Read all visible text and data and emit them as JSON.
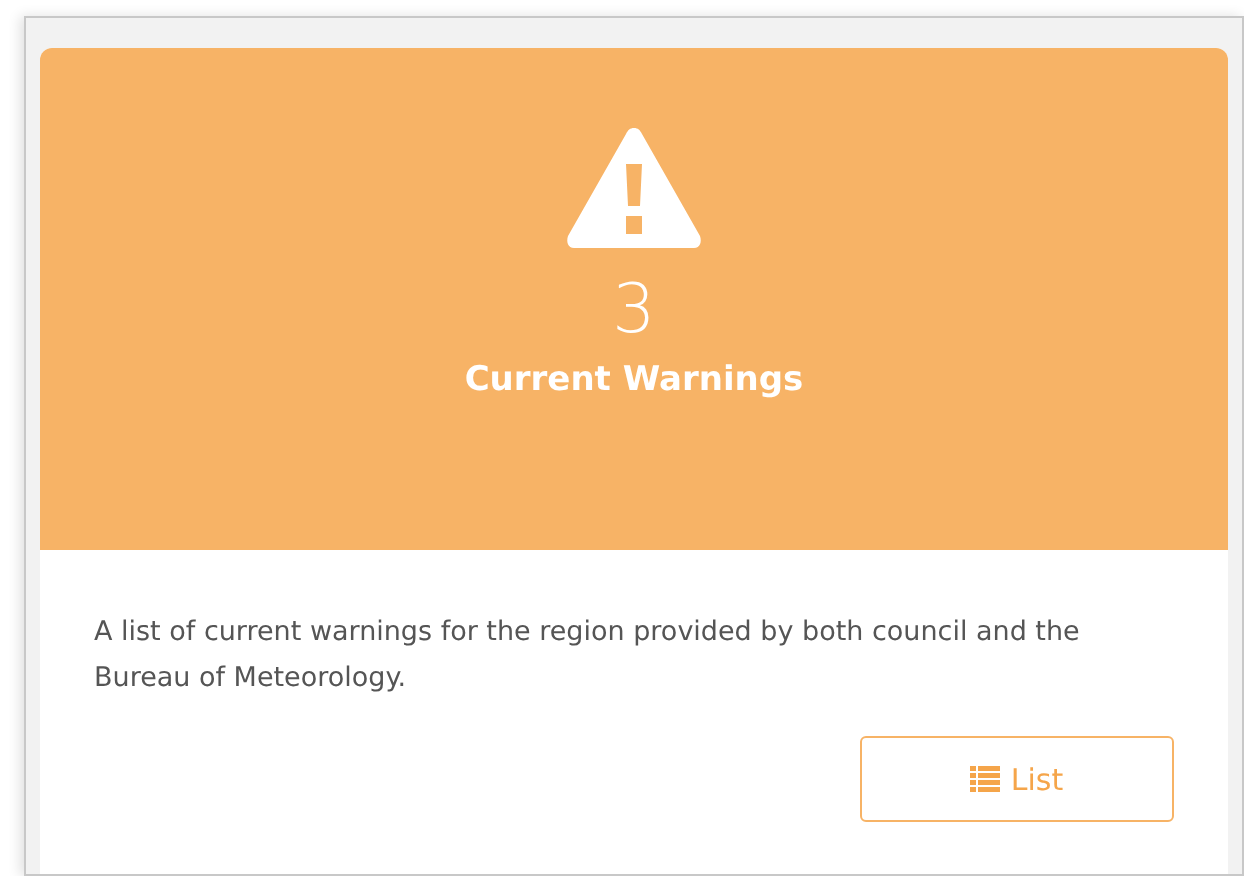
{
  "card": {
    "count": "3",
    "title": "Current Warnings",
    "description": "A list of current warnings for the region provided by both council and the Bureau of Meteorology.",
    "button": {
      "label": "List"
    }
  }
}
